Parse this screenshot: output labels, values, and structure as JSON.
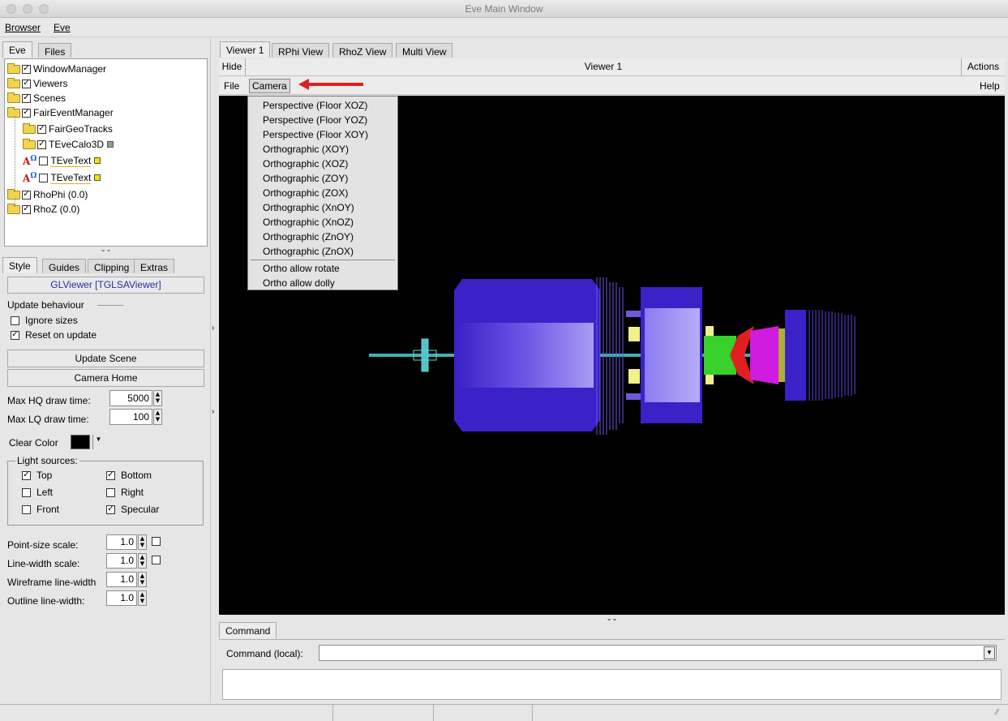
{
  "window": {
    "title": "Eve Main Window"
  },
  "menubar": {
    "browser": "Browser",
    "eve": "Eve"
  },
  "left_tabs": {
    "eve": "Eve",
    "files": "Files"
  },
  "tree": {
    "items": [
      {
        "label": "WindowManager",
        "checked": "✓"
      },
      {
        "label": "Viewers",
        "checked": "✓"
      },
      {
        "label": "Scenes",
        "checked": "✓"
      },
      {
        "label": "FairEventManager",
        "checked": "✓"
      },
      {
        "label": "FairGeoTracks",
        "checked": "✓"
      },
      {
        "label": "TEveCalo3D",
        "checked": "✓"
      },
      {
        "label": "TEveText",
        "checked": ""
      },
      {
        "label": "TEveText",
        "checked": ""
      },
      {
        "label": "RhoPhi (0.0)",
        "checked": "✓"
      },
      {
        "label": "RhoZ (0.0)",
        "checked": "✓"
      }
    ],
    "splitter": "⌄⌄"
  },
  "style_tabs": {
    "style": "Style",
    "guides": "Guides",
    "clipping": "Clipping",
    "extras": "Extras"
  },
  "editor": {
    "viewer_name": "GLViewer [TGLSAViewer]",
    "update_behaviour": "Update behaviour",
    "ignore_sizes": "Ignore sizes",
    "reset_on_update": "Reset on update",
    "update_scene": "Update Scene",
    "camera_home": "Camera Home",
    "max_hq_label": "Max HQ draw time:",
    "max_hq_value": "5000",
    "max_lq_label": "Max LQ draw time:",
    "max_lq_value": "100",
    "clear_color_label": "Clear Color",
    "clear_color": "#000000",
    "light_sources": "Light sources:",
    "top": "Top",
    "bottom": "Bottom",
    "left": "Left",
    "right": "Right",
    "front": "Front",
    "specular": "Specular",
    "point_size_label": "Point-size scale:",
    "point_size_value": "1.0",
    "line_width_label": "Line-width scale:",
    "line_width_value": "1.0",
    "wireframe_label": "Wireframe line-width",
    "wireframe_value": "1.0",
    "outline_label": "Outline line-width:",
    "outline_value": "1.0"
  },
  "viewer_tabs": [
    "Viewer 1",
    "RPhi View",
    "RhoZ View",
    "Multi View"
  ],
  "viewer": {
    "hide": "Hide",
    "title": "Viewer 1",
    "actions": "Actions",
    "file_menu": "File",
    "camera_menu": "Camera",
    "help_menu": "Help"
  },
  "camera_menu": {
    "items": [
      "Perspective (Floor XOZ)",
      "Perspective (Floor YOZ)",
      "Perspective (Floor XOY)",
      "Orthographic (XOY)",
      "Orthographic (XOZ)",
      "Orthographic (ZOY)",
      "Orthographic (ZOX)",
      "Orthographic (XnOY)",
      "Orthographic (XnOZ)",
      "Orthographic (ZnOY)",
      "Orthographic (ZnOX)"
    ],
    "extra_items": [
      "Ortho allow rotate",
      "Ortho allow dolly"
    ]
  },
  "command": {
    "tab": "Command",
    "label": "Command (local):",
    "value": ""
  },
  "colors": {
    "annotation_arrow": "#e02020",
    "geometry_blue": "#3a22c8",
    "geometry_light": "#8e80f0",
    "tracks": "#40b0b8"
  }
}
